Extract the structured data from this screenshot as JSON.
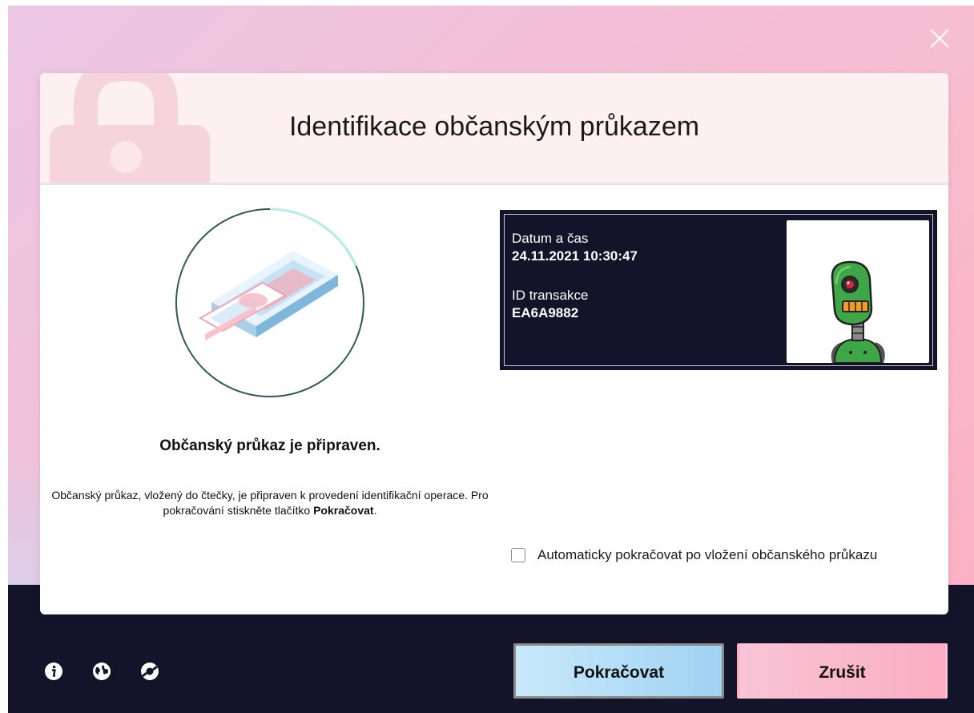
{
  "dialog": {
    "title": "Identifikace občanským průkazem"
  },
  "status": {
    "heading": "Občanský průkaz je připraven.",
    "text_before": "Občanský průkaz, vložený do čtečky, je připraven k provedení identifikační operace. Pro pokračování stiskněte tlačítko ",
    "text_bold": "Pokračovat",
    "text_after": "."
  },
  "info": {
    "datetime_label": "Datum a čas",
    "datetime_value": "24.11.2021 10:30:47",
    "transaction_label": "ID transakce",
    "transaction_value": "EA6A9882"
  },
  "auto_continue": {
    "label": "Automaticky pokračovat po vložení občanského průkazu",
    "checked": false
  },
  "buttons": {
    "continue_label": "Pokračovat",
    "cancel_label": "Zrušit"
  },
  "footer_icons": [
    "info-icon",
    "globe-icon",
    "help-icon"
  ],
  "colors": {
    "dark": "#13132a",
    "continue_button": "#9fd3f2",
    "cancel_button": "#fbadc2",
    "header_bg": "#fdf0f2"
  }
}
